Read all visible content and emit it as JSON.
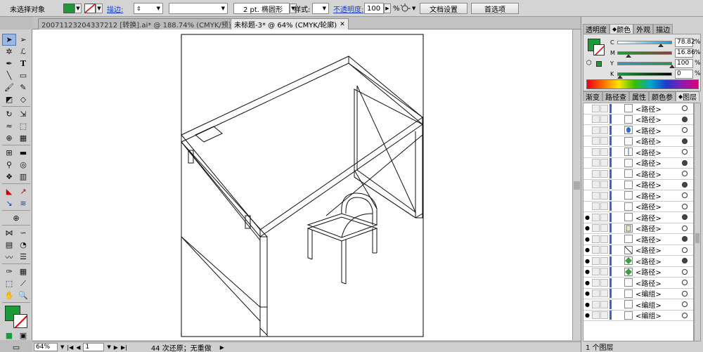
{
  "control_bar": {
    "selection_status": "未选择对象",
    "stroke_label": "描边:",
    "brush_size": "2 pt. 椭圆形",
    "style_label": "样式:",
    "opacity_label": "不透明度:",
    "opacity_value": "100",
    "opacity_unit": "%",
    "doc_setup_label": "文档设置",
    "preferences_label": "首选项",
    "fill_color": "#1e9a3a"
  },
  "document_tabs": [
    {
      "label": "20071123204337212 [转换].ai* @ 188.74% (CMYK/预览)",
      "close": "✕"
    },
    {
      "label": "未标题-3* @ 64% (CMYK/轮廓)",
      "close": "✕"
    }
  ],
  "tools": [
    "selection-tool",
    "direct-selection-tool",
    "magic-wand-tool",
    "lasso-tool",
    "pen-tool",
    "type-tool",
    "line-tool",
    "rectangle-tool",
    "paintbrush-tool",
    "pencil-tool",
    "blob-brush-tool",
    "eraser-tool",
    "rotate-tool",
    "scale-tool",
    "warp-tool",
    "free-transform-tool",
    "shape-builder-tool",
    "perspective-grid-tool",
    "mesh-tool",
    "gradient-tool",
    "eyedropper-tool",
    "blend-tool",
    "symbol-sprayer-tool",
    "column-graph-tool",
    "artboard-tool",
    "slice-tool",
    "hand-tool",
    "zoom-tool"
  ],
  "status_bar": {
    "zoom": "64%",
    "artboard_number": "1",
    "undo_info": "44 次还原；无重做"
  },
  "color_panel": {
    "tabs": [
      "透明度",
      "颜色",
      "外观",
      "描边"
    ],
    "active_tab": "颜色",
    "channels": [
      {
        "name": "C",
        "value": "78.82",
        "unit": "%",
        "level": 0.7882
      },
      {
        "name": "M",
        "value": "16.86",
        "unit": "%",
        "level": 0.1686
      },
      {
        "name": "Y",
        "value": "100",
        "unit": "%",
        "level": 1.0
      },
      {
        "name": "K",
        "value": "0",
        "unit": "%",
        "level": 0.0
      }
    ],
    "fill_color": "#1e9a3a"
  },
  "layers_panel": {
    "tabs": [
      "渐变",
      "路径查",
      "属性",
      "颜色参",
      "图层"
    ],
    "active_tab": "图层",
    "items": [
      {
        "name": "<路径>",
        "visible": false,
        "thumb": "",
        "targeted": false
      },
      {
        "name": "<路径>",
        "visible": false,
        "thumb": "",
        "targeted": true
      },
      {
        "name": "<路径>",
        "visible": false,
        "thumb": "blue-ellipse",
        "targeted": false
      },
      {
        "name": "<路径>",
        "visible": false,
        "thumb": "",
        "targeted": true
      },
      {
        "name": "<路径>",
        "visible": false,
        "thumb": "line",
        "targeted": false
      },
      {
        "name": "<路径>",
        "visible": false,
        "thumb": "",
        "targeted": true
      },
      {
        "name": "<路径>",
        "visible": false,
        "thumb": "",
        "targeted": false
      },
      {
        "name": "<路径>",
        "visible": false,
        "thumb": "",
        "targeted": true
      },
      {
        "name": "<路径>",
        "visible": false,
        "thumb": "",
        "targeted": false
      },
      {
        "name": "<路径>",
        "visible": false,
        "thumb": "",
        "targeted": false
      },
      {
        "name": "<路径>",
        "visible": true,
        "thumb": "",
        "targeted": true
      },
      {
        "name": "<路径>",
        "visible": true,
        "thumb": "shape",
        "targeted": false
      },
      {
        "name": "<路径>",
        "visible": true,
        "thumb": "",
        "targeted": true
      },
      {
        "name": "<路径>",
        "visible": true,
        "thumb": "diagonal",
        "targeted": false
      },
      {
        "name": "<路径>",
        "visible": true,
        "thumb": "green-shape",
        "targeted": true
      },
      {
        "name": "<路径>",
        "visible": true,
        "thumb": "green-shape",
        "targeted": false
      },
      {
        "name": "<路径>",
        "visible": true,
        "thumb": "",
        "targeted": false
      },
      {
        "name": "<编组>",
        "visible": true,
        "thumb": "",
        "targeted": false
      },
      {
        "name": "<编组>",
        "visible": true,
        "thumb": "",
        "targeted": false
      },
      {
        "name": "<编组>",
        "visible": true,
        "thumb": "",
        "targeted": false
      }
    ],
    "footer": "1 个图层"
  }
}
